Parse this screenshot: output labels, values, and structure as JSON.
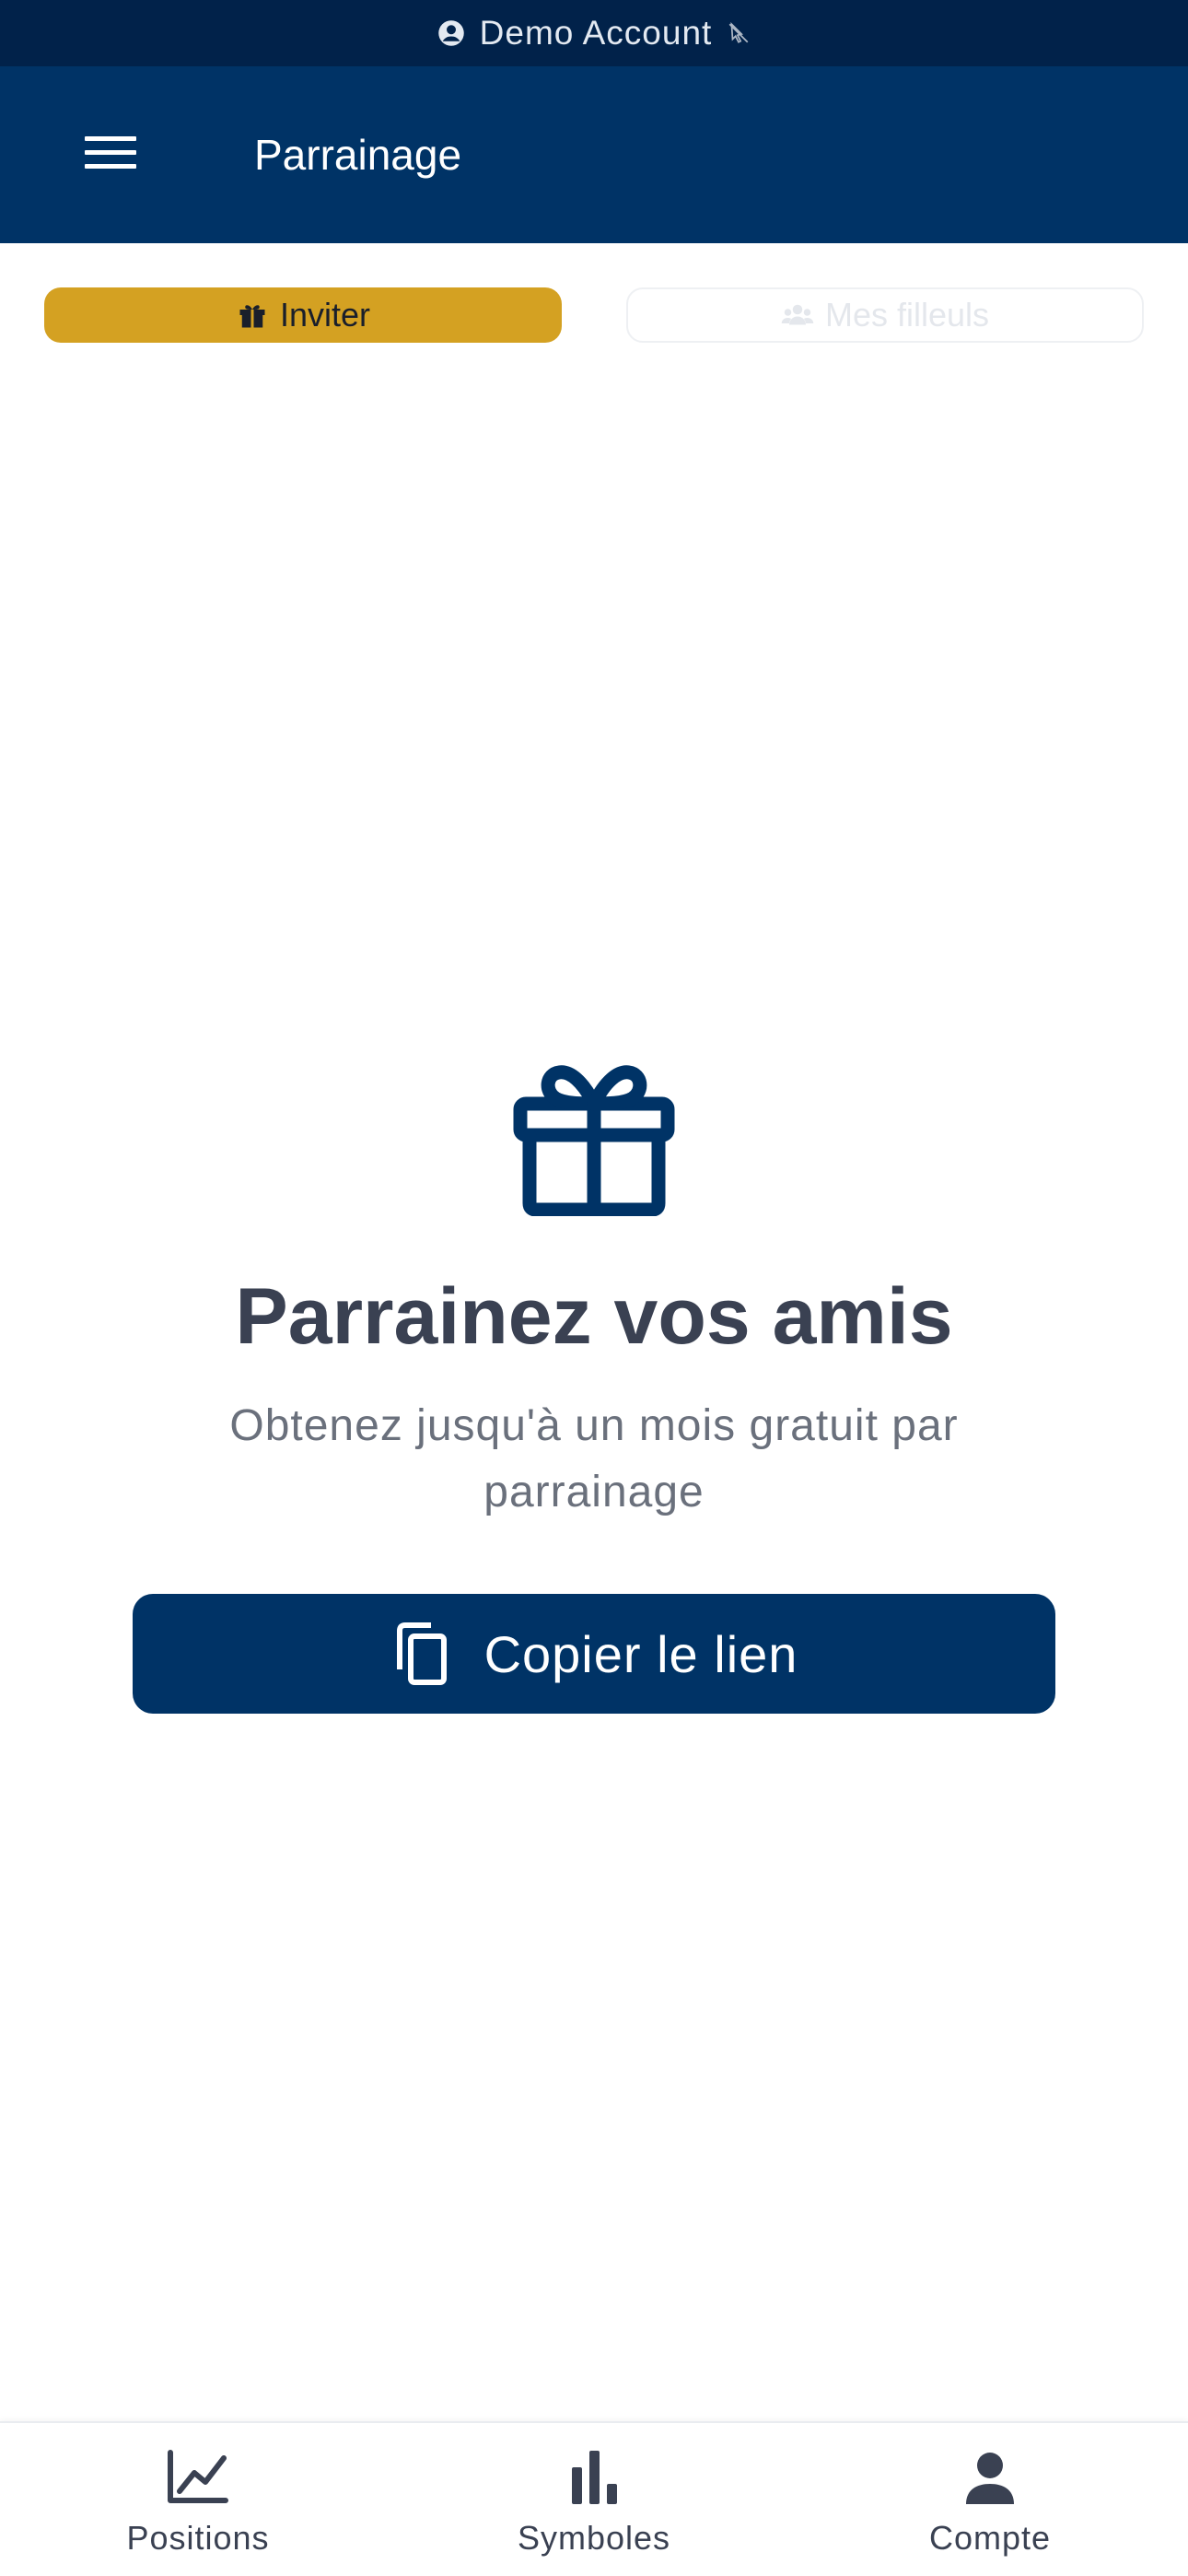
{
  "demo_banner": {
    "text": "Demo Account",
    "icon": "account-circle-icon",
    "end_icon": "cursor-off-icon"
  },
  "header": {
    "title": "Parrainage",
    "menu_icon": "hamburger-menu-icon"
  },
  "tabs": [
    {
      "label": "Inviter",
      "icon": "gift-icon",
      "active": true
    },
    {
      "label": "Mes filleuls",
      "icon": "users-icon",
      "active": false
    }
  ],
  "hero": {
    "icon": "gift-icon",
    "headline": "Parrainez vos amis",
    "subtext": "Obtenez jusqu'à un mois gratuit par parrainage",
    "button_label": "Copier le lien",
    "button_icon": "copy-icon"
  },
  "bottom_nav": [
    {
      "label": "Positions",
      "icon": "line-chart-icon"
    },
    {
      "label": "Symboles",
      "icon": "bar-chart-icon"
    },
    {
      "label": "Compte",
      "icon": "person-icon"
    }
  ],
  "colors": {
    "brand_navy": "#003366",
    "banner_dark": "#01224a",
    "accent_gold": "#d4a122",
    "text_dark": "#3a4152",
    "text_muted": "#6a707c"
  }
}
